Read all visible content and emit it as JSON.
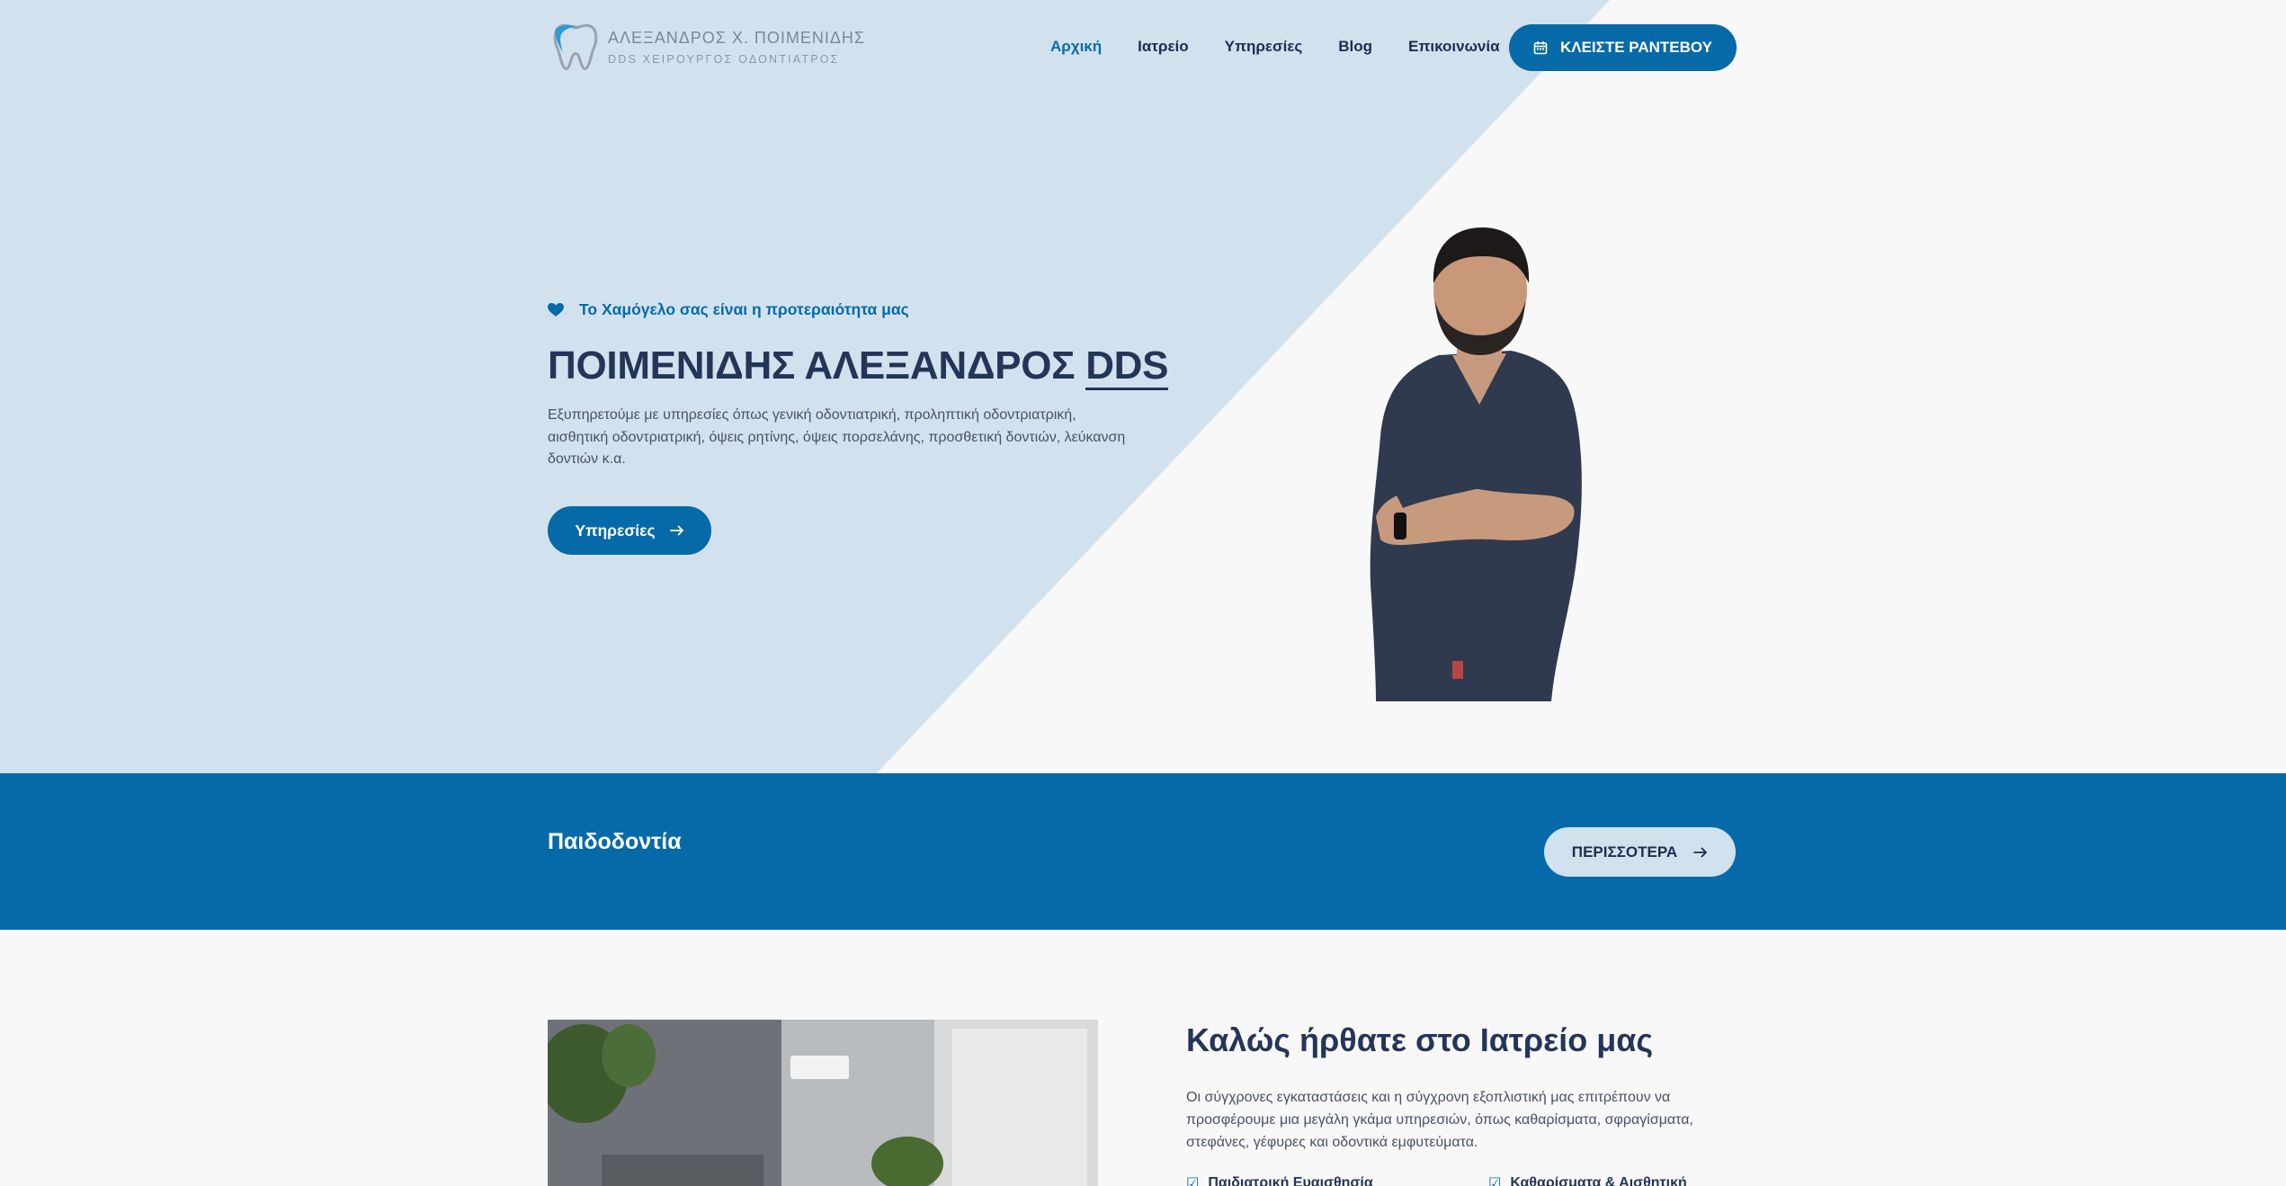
{
  "header": {
    "logo": {
      "name": "ΑΛΕΞΑΝΔΡΟΣ Χ. ΠΟΙΜΕΝΙΔΗΣ",
      "subtitle": "DDS ΧΕΙΡΟΥΡΓΟΣ ΟΔΟΝΤΙΑΤΡΟΣ"
    },
    "nav": [
      {
        "label": "Αρχική",
        "active": true
      },
      {
        "label": "Ιατρείο",
        "active": false
      },
      {
        "label": "Υπηρεσίες",
        "active": false
      },
      {
        "label": "Blog",
        "active": false
      },
      {
        "label": "Επικοινωνία",
        "active": false
      }
    ],
    "cta_label": "ΚΛΕΙΣΤΕ ΡΑΝΤΕΒΟΥ",
    "cta_icon": "calendar-icon"
  },
  "hero": {
    "tagline": "Το Χαμόγελο σας είναι η προτεραιότητα μας",
    "tagline_icon": "heart-icon",
    "title_main": "ΠΟΙΜΕΝΙΔΗΣ ΑΛΕΞΑΝΔΡΟΣ",
    "title_suffix": "DDS",
    "description": "Εξυπηρετούμε με υπηρεσίες όπως γενική οδοντιατρική, προληπτική οδοντριατρική, αισθητική οδοντριατρική, όψεις ρητίνης, όψεις πορσελάνης, προσθετική δοντιών, λεύκανση δοντιών κ.α.",
    "button_label": "Υπηρεσίες",
    "button_icon": "arrow-right-icon"
  },
  "band": {
    "title": "Παιδοδοντία",
    "button_label": "ΠΕΡΙΣΣΟΤΕΡΑ",
    "button_icon": "arrow-right-icon"
  },
  "welcome": {
    "title": "Καλώς ήρθατε στο Ιατρείο μας",
    "description": "Οι σύγχρονες εγκαταστάσεις και η σύγχρονη εξοπλιστική μας επιτρέπουν να προσφέρουμε μια μεγάλη γκάμα υπηρεσιών, όπως καθαρίσματα, σφραγίσματα, στεφάνες, γέφυρες και οδοντικά εμφυτεύματα.",
    "features": [
      "Παιδιατρική Ευαισθησία",
      "Καθαρίσματα & Αισθητική"
    ]
  },
  "colors": {
    "primary": "#066aa8",
    "hero_light": "#d1e2ee",
    "heading": "#243558",
    "background": "#f8f8f8"
  }
}
